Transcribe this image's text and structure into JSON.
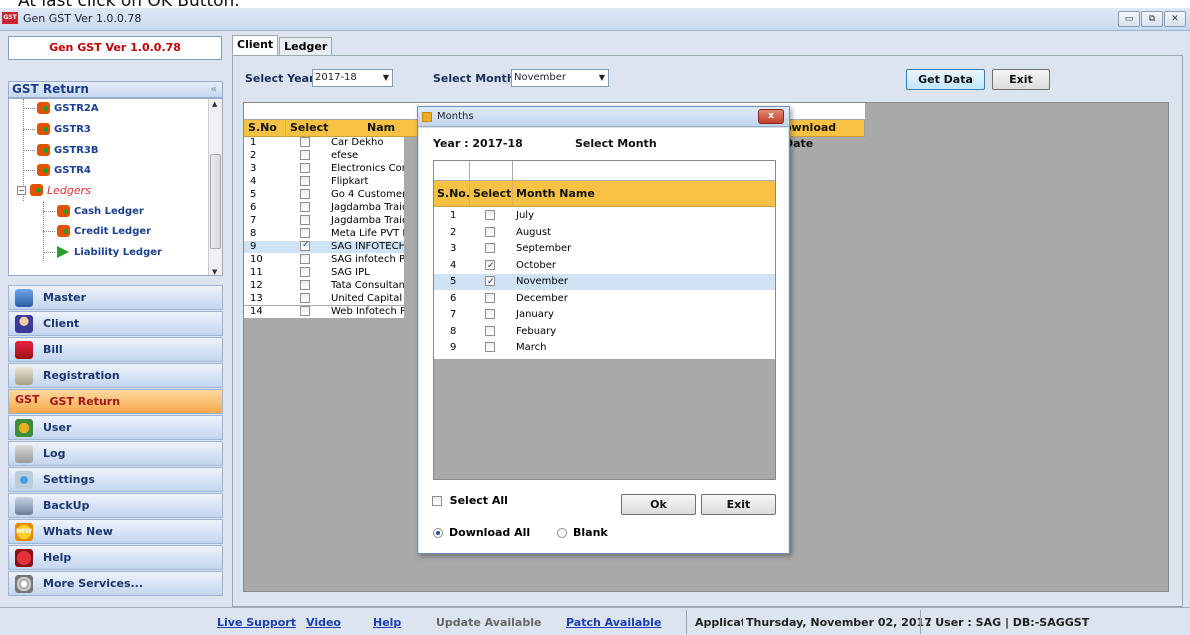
{
  "caption": "At last click on OK Button.",
  "window": {
    "title": "Gen GST Ver 1.0.0.78",
    "icon_text": "GST"
  },
  "sidebar": {
    "version_label": "Gen GST  Ver 1.0.0.78",
    "gst_return_header": "GST Return",
    "tree_items": [
      {
        "label": "GSTR2A",
        "icon": "gst-leaf-icon"
      },
      {
        "label": "GSTR3",
        "icon": "gst-leaf-icon"
      },
      {
        "label": "GSTR3B",
        "icon": "gst-leaf-icon"
      },
      {
        "label": "GSTR4",
        "icon": "gst-leaf-icon"
      },
      {
        "label": "Ledgers",
        "icon": "gst-leaf-icon"
      },
      {
        "label": "Cash Ledger",
        "icon": "gst-leaf-icon"
      },
      {
        "label": "Credit Ledger",
        "icon": "gst-leaf-icon"
      },
      {
        "label": "Liability Ledger",
        "icon": "play-arrow-icon"
      }
    ],
    "nav": [
      {
        "label": "Master",
        "icon": "master-icon"
      },
      {
        "label": "Client",
        "icon": "client-icon"
      },
      {
        "label": "Bill",
        "icon": "bill-icon"
      },
      {
        "label": "Registration",
        "icon": "registration-icon"
      },
      {
        "label": "GST Return",
        "icon": "gst-return-icon",
        "icon_text": "GST",
        "active": true
      },
      {
        "label": "User",
        "icon": "user-icon"
      },
      {
        "label": "Log",
        "icon": "log-icon"
      },
      {
        "label": "Settings",
        "icon": "settings-icon"
      },
      {
        "label": "BackUp",
        "icon": "backup-icon"
      },
      {
        "label": "Whats New",
        "icon": "whats-new-icon",
        "icon_text": "NEW"
      },
      {
        "label": "Help",
        "icon": "help-icon"
      },
      {
        "label": "More Services...",
        "icon": "more-services-icon"
      }
    ]
  },
  "main": {
    "tabs": [
      "Client",
      "Ledger"
    ],
    "select_year_label": "Select Year",
    "year_value": "2017-18",
    "select_month_label": "Select Month",
    "month_value": "November",
    "get_data_label": "Get Data",
    "exit_label": "Exit",
    "grid": {
      "headers": [
        "S.No",
        "Select",
        "Name",
        "Download Date"
      ],
      "header_visible": {
        "name": "Nam",
        "download": "ownload Date"
      },
      "rows": [
        {
          "no": "1",
          "checked": false,
          "name": "Car Dekho"
        },
        {
          "no": "2",
          "checked": false,
          "name": "efese"
        },
        {
          "no": "3",
          "checked": false,
          "name": "Electronics Compr"
        },
        {
          "no": "4",
          "checked": false,
          "name": "Flipkart"
        },
        {
          "no": "5",
          "checked": false,
          "name": "Go 4 Customer"
        },
        {
          "no": "6",
          "checked": false,
          "name": "Jagdamba Traidin"
        },
        {
          "no": "7",
          "checked": false,
          "name": "Jagdamba Traidin"
        },
        {
          "no": "8",
          "checked": false,
          "name": "Meta Life PVT LTD"
        },
        {
          "no": "9",
          "checked": true,
          "name": "SAG INFOTECH",
          "selected": true
        },
        {
          "no": "10",
          "checked": false,
          "name": "SAG infotech PVT"
        },
        {
          "no": "11",
          "checked": false,
          "name": "SAG IPL"
        },
        {
          "no": "12",
          "checked": false,
          "name": "Tata Consultancy S"
        },
        {
          "no": "13",
          "checked": false,
          "name": "United Capital Clu"
        },
        {
          "no": "14",
          "checked": false,
          "name": "Web Infotech PVT"
        }
      ]
    }
  },
  "dialog": {
    "title": "Months",
    "close_label": "x",
    "year_label": "Year : 2017-18",
    "select_month_label": "Select Month",
    "headers": [
      "S.No.",
      "Select",
      "Month Name"
    ],
    "months": [
      {
        "no": "1",
        "checked": false,
        "name": "July"
      },
      {
        "no": "2",
        "checked": false,
        "name": "August"
      },
      {
        "no": "3",
        "checked": false,
        "name": "September"
      },
      {
        "no": "4",
        "checked": true,
        "name": "October"
      },
      {
        "no": "5",
        "checked": true,
        "name": "November",
        "selected": true
      },
      {
        "no": "6",
        "checked": false,
        "name": "December"
      },
      {
        "no": "7",
        "checked": false,
        "name": "January"
      },
      {
        "no": "8",
        "checked": false,
        "name": "Febuary"
      },
      {
        "no": "9",
        "checked": false,
        "name": "March"
      }
    ],
    "select_all_label": "Select All",
    "ok_label": "Ok",
    "exit_label": "Exit",
    "download_all_label": "Download All",
    "blank_label": "Blank",
    "download_all_selected": true
  },
  "statusbar": {
    "live_support": "Live Support",
    "video": "Video",
    "help": "Help",
    "update_available": "Update Available",
    "patch_available": "Patch Available",
    "application_text": "Applicatio",
    "date_text": "Thursday, November 02, 2017",
    "user_text": ": User : SAG  |  DB:-SAGGST"
  },
  "colors": {
    "header_orange": "#f7c244",
    "active_nav": "#f8a94a",
    "link_blue": "#1a3fb0",
    "version_red": "#c00000"
  }
}
